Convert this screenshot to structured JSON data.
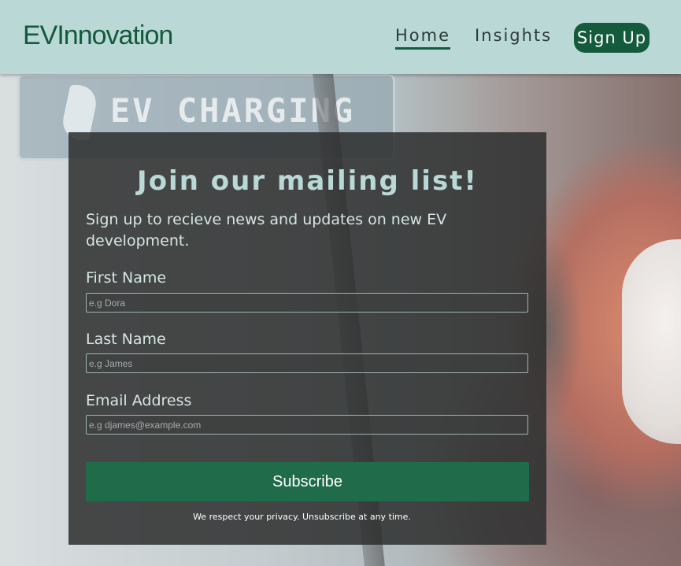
{
  "header": {
    "brand": "EVInnovation",
    "nav": {
      "home": "Home",
      "insights": "Insights",
      "signup": "Sign Up"
    }
  },
  "hero": {
    "sign_text": "EV CHARGING"
  },
  "form": {
    "title": "Join our mailing list!",
    "subtitle": "Sign up to recieve news and updates on new EV development.",
    "first_name": {
      "label": "First Name",
      "placeholder": "e.g Dora",
      "value": ""
    },
    "last_name": {
      "label": "Last Name",
      "placeholder": "e.g James",
      "value": ""
    },
    "email": {
      "label": "Email Address",
      "placeholder": "e.g djames@example.com",
      "value": ""
    },
    "submit_label": "Subscribe",
    "privacy_note": "We respect your privacy. Unsubscribe at any time."
  },
  "colors": {
    "header_bg": "#b9d8d6",
    "brand_green": "#145a3c",
    "card_bg": "#2d2f2f",
    "button_green": "#1f6b4a",
    "title_color": "#b9d8d6"
  },
  "active_nav": "Home"
}
